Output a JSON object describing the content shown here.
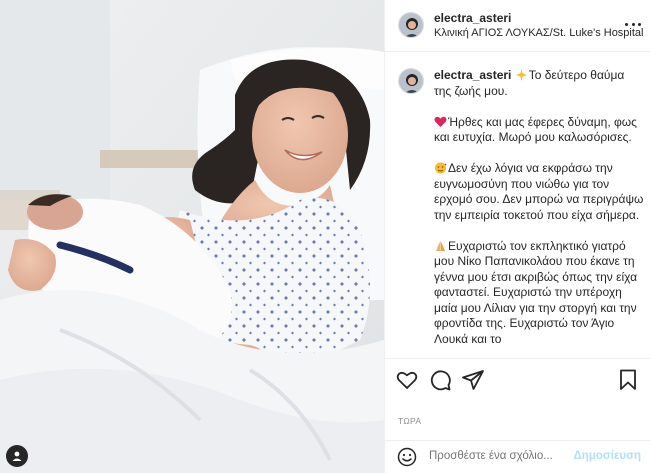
{
  "post": {
    "username": "electra_asteri",
    "location": "Κλινική ΑΓΙΟΣ ΛΟΥΚΑΣ/St. Luke's Hospital"
  },
  "caption": {
    "username": "electra_asteri",
    "paragraphs": [
      {
        "emoji": "sparkles",
        "text": "Το δεύτερο θαύμα της ζωής μου."
      },
      {
        "emoji": "red-heart",
        "text": "Ήρθες και μας έφερες δύναμη, φως και ευτυχία. Μωρό μου καλωσόρισες."
      },
      {
        "emoji": "smiling-hearts-face",
        "text": "Δεν έχω λόγια να εκφράσω την ευγνωμοσύνη που νιώθω για τον ερχομό σου. Δεν μπορώ να περιγράψω την εμπειρία τοκετού που είχα σήμερα."
      },
      {
        "emoji": "praying-hands",
        "text": "Ευχαριστώ τον εκπληκτικό γιατρό μου Νίκο Παπανικολάου που έκανε τη γέννα μου έτσι ακριβώς όπως την είχα φανταστεί. Ευχαριστώ την υπέροχη μαία μου Λίλιαν για την στοργή και την φροντίδα της. Ευχαριστώ τον Άγιο Λουκά και το"
      }
    ]
  },
  "icons": {
    "like": "heart-icon",
    "comment": "comment-icon",
    "share": "paper-plane-icon",
    "save": "bookmark-icon",
    "more": "more-options-icon",
    "emoji_picker": "smiley-icon",
    "tagged": "user-tag-icon"
  },
  "date_label": "ΤΩΡΑ",
  "comment": {
    "placeholder": "Προσθέστε ένα σχόλιο...",
    "publish_label": "Δημοσίευση"
  },
  "colors": {
    "text": "#262626",
    "muted": "#8e8e8e",
    "divider": "#efefef",
    "publish_disabled": "#b2dffc",
    "heart_emoji": "#e0245e"
  }
}
